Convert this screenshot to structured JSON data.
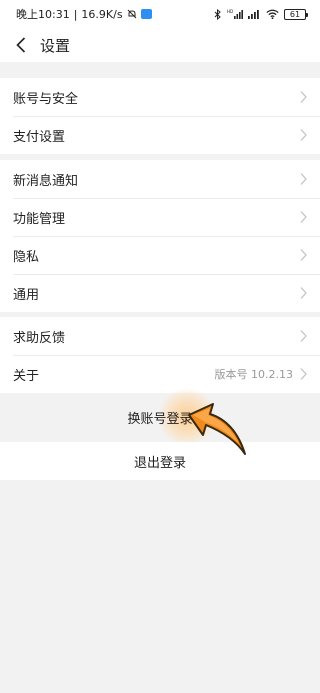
{
  "status_bar": {
    "time": "晚上10:31",
    "speed": "16.9K/s",
    "battery": "61"
  },
  "header": {
    "title": "设置"
  },
  "groups": [
    {
      "items": [
        {
          "label": "账号与安全"
        },
        {
          "label": "支付设置"
        }
      ]
    },
    {
      "items": [
        {
          "label": "新消息通知"
        },
        {
          "label": "功能管理"
        },
        {
          "label": "隐私"
        },
        {
          "label": "通用"
        }
      ]
    },
    {
      "items": [
        {
          "label": "求助反馈"
        },
        {
          "label": "关于",
          "value": "版本号 10.2.13"
        }
      ]
    }
  ],
  "actions": {
    "switch_account": "换账号登录",
    "logout": "退出登录"
  },
  "colors": {
    "background": "#f2f2f2",
    "surface": "#ffffff",
    "pointer_orange": "#f08a1c"
  },
  "icons": [
    "cloud-icon",
    "bluetooth-icon",
    "hd-icon",
    "signal-icon",
    "wifi-icon",
    "battery-icon",
    "back-arrow-icon",
    "chevron-right-icon",
    "pointer-arrow-icon"
  ]
}
